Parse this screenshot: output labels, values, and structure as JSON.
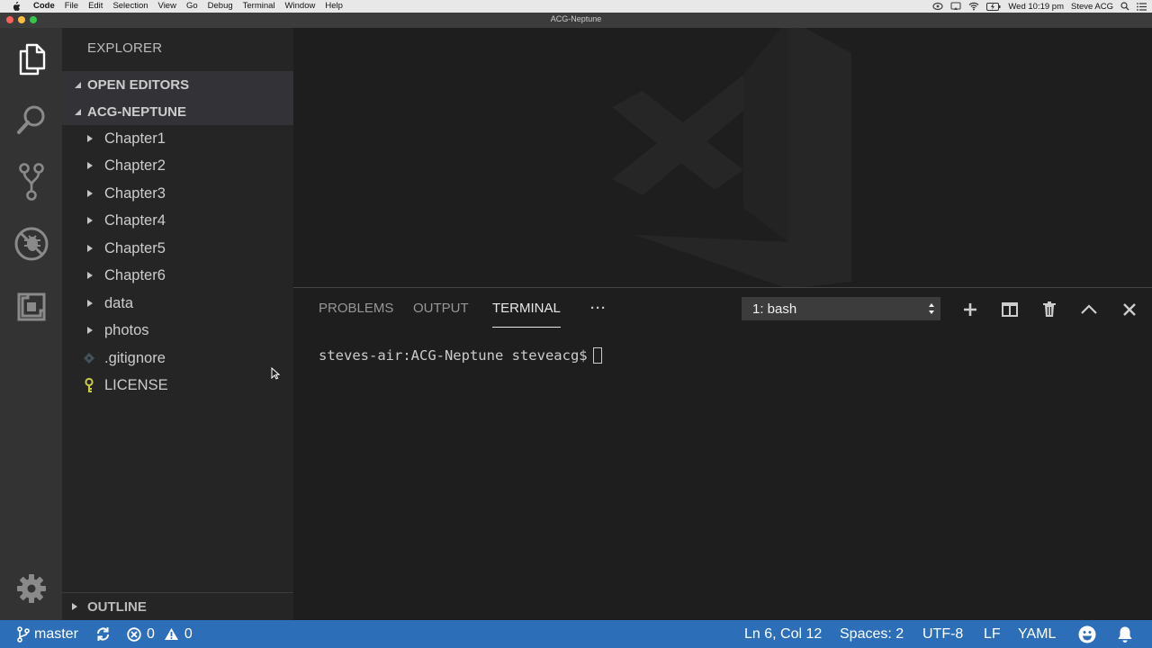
{
  "menubar": {
    "app_name": "Code",
    "items": [
      "File",
      "Edit",
      "Selection",
      "View",
      "Go",
      "Debug",
      "Terminal",
      "Window",
      "Help"
    ],
    "clock": "Wed 10:19 pm",
    "user": "Steve ACG"
  },
  "window": {
    "title": "ACG-Neptune"
  },
  "sidebar": {
    "title": "EXPLORER",
    "open_editors": "OPEN EDITORS",
    "project": "ACG-NEPTUNE",
    "folders": [
      "Chapter1",
      "Chapter2",
      "Chapter3",
      "Chapter4",
      "Chapter5",
      "Chapter6",
      "data",
      "photos"
    ],
    "files": [
      ".gitignore",
      "LICENSE"
    ],
    "outline": "OUTLINE"
  },
  "panel": {
    "tabs": [
      "PROBLEMS",
      "OUTPUT",
      "TERMINAL"
    ],
    "active_tab": "TERMINAL",
    "more_label": "···",
    "terminal_selected": "1: bash",
    "prompt": "steves-air:ACG-Neptune steveacg$"
  },
  "statusbar": {
    "branch": "master",
    "errors": "0",
    "warnings": "0",
    "position": "Ln 6, Col 12",
    "spaces": "Spaces: 2",
    "encoding": "UTF-8",
    "eol": "LF",
    "language": "YAML"
  },
  "colors": {
    "status_bar": "#2c6fb8",
    "activity_bar": "#333333",
    "sidebar": "#252526",
    "editor": "#1e1e1e",
    "folder_twist": "#c5c5c5",
    "gitignore_icon": "#41535b",
    "license_icon": "#cbcb41"
  }
}
